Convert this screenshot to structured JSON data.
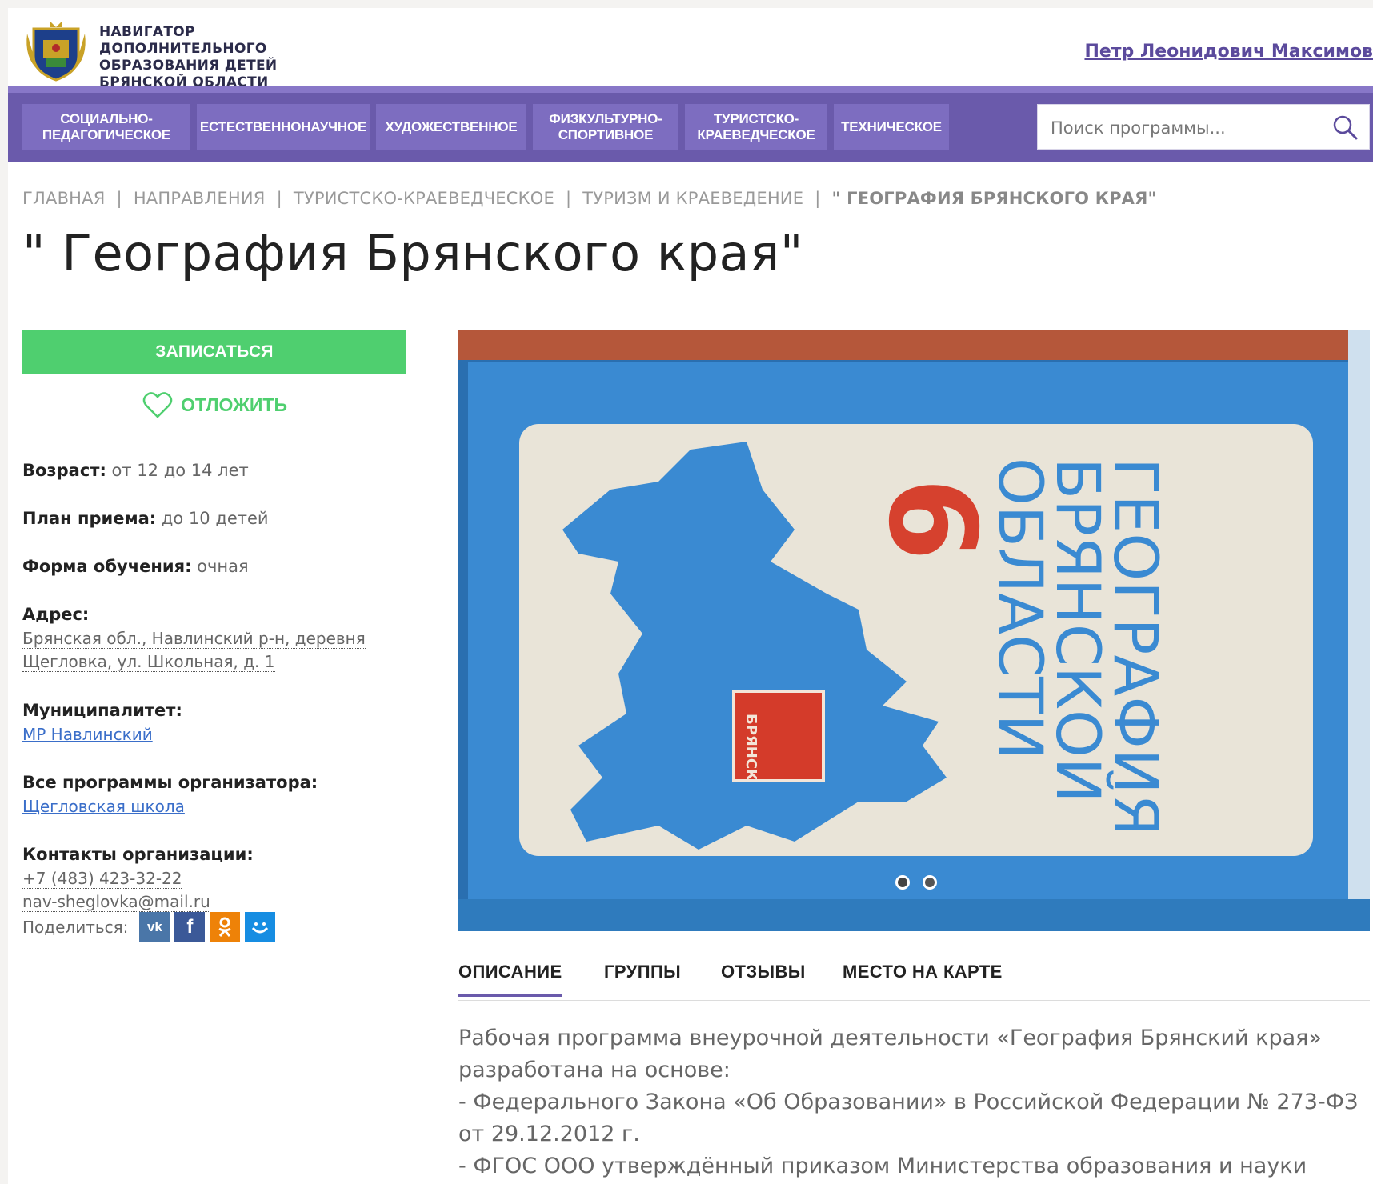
{
  "header": {
    "site_title": "Навигатор дополнительного образования детей Брянской области",
    "user_name": "Петр Леонидович Максимов"
  },
  "nav": {
    "items": [
      "Социально-педагогическое",
      "Естественнонаучное",
      "Художественное",
      "Физкультурно-спортивное",
      "Туристско-краеведческое",
      "Техническое"
    ],
    "search_placeholder": "Поиск программы..."
  },
  "breadcrumb": {
    "items": [
      "ГЛАВНАЯ",
      "НАПРАВЛЕНИЯ",
      "ТУРИСТСКО-КРАЕВЕДЧЕСКОЕ",
      "ТУРИЗМ И КРАЕВЕДЕНИЕ"
    ],
    "current": "\" ГЕОГРАФИЯ БРЯНСКОГО КРАЯ\""
  },
  "page_title": "\" География Брянского края\"",
  "actions": {
    "signup": "ЗАПИСАТЬСЯ",
    "postpone": "ОТЛОЖИТЬ"
  },
  "info": {
    "age_label": "Возраст:",
    "age_value": "от 12 до 14 лет",
    "plan_label": "План приема:",
    "plan_value": "до 10 детей",
    "form_label": "Форма обучения:",
    "form_value": "очная",
    "address_label": "Адрес:",
    "address_line1": "Брянская обл., Навлинский р-н, деревня",
    "address_line2": "Щегловка, ул. Школьная, д. 1",
    "municipality_label": "Муниципалитет:",
    "municipality_value": "МР Навлинский",
    "organizer_label": "Все программы организатора:",
    "organizer_value": "Щегловская школа",
    "contacts_label": "Контакты организации:",
    "phone": "+7 (483) 423-32-22",
    "email": "nav-sheglovka@mail.ru",
    "share_label": "Поделиться:"
  },
  "gallery": {
    "book_title_line1": "ГЕОГРАФИЯ",
    "book_title_line2": "БРЯНСКОЙ",
    "book_title_line3": "ОБЛАСТИ",
    "grade": "6",
    "emblem_text": "БРЯНСК",
    "slide_count": 2,
    "active_slide": 1
  },
  "tabs": [
    "ОПИСАНИЕ",
    "ГРУППЫ",
    "ОТЗЫВЫ",
    "МЕСТО НА КАРТЕ"
  ],
  "description": {
    "line1": "Рабочая программа внеурочной деятельности «География Брянский края»",
    "line2": "разработана на основе:",
    "line3": "- Федерального Закона «Об Образовании» в Российской Федерации № 273-ФЗ",
    "line4": "от 29.12.2012 г.",
    "line5": "- ФГОС ООО утверждённый приказом Министерства образования и науки"
  },
  "colors": {
    "brand_purple": "#6a5aab",
    "nav_item": "#7d6dc0",
    "accent_green": "#4fcf6f",
    "link_blue": "#3a6ec9"
  }
}
